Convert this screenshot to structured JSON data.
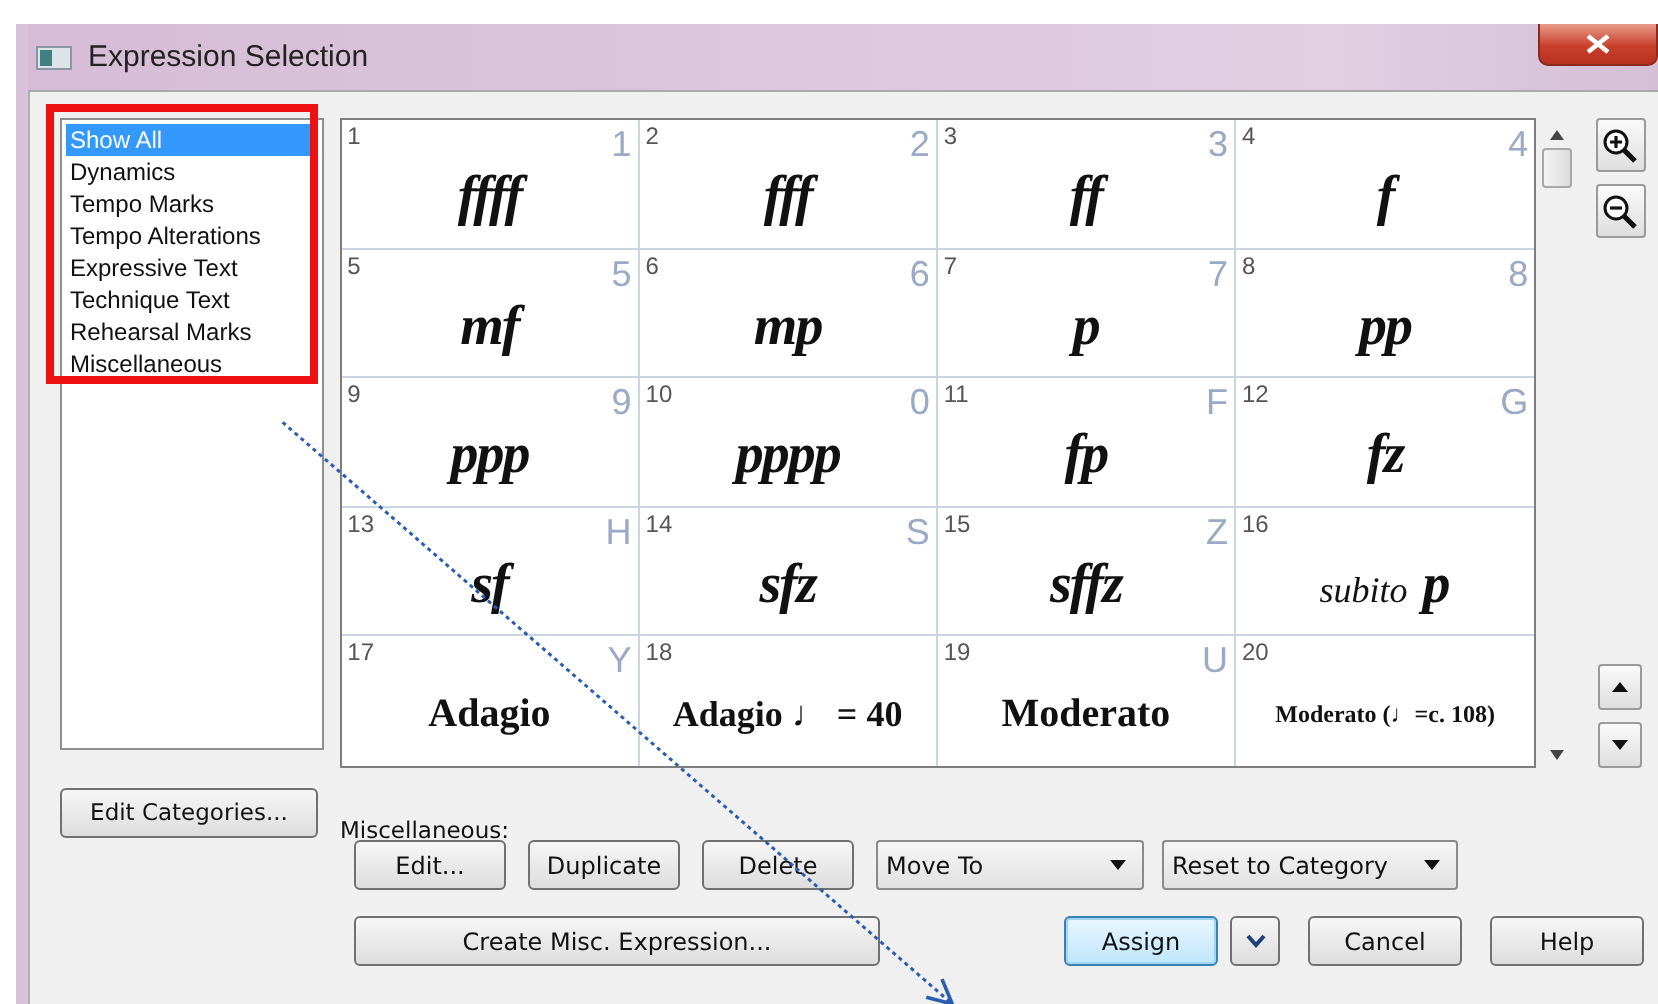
{
  "window": {
    "title": "Expression Selection"
  },
  "categories": [
    {
      "label": "Show All",
      "selected": true
    },
    {
      "label": "Dynamics",
      "selected": false
    },
    {
      "label": "Tempo Marks",
      "selected": false
    },
    {
      "label": "Tempo Alterations",
      "selected": false
    },
    {
      "label": "Expressive Text",
      "selected": false
    },
    {
      "label": "Technique Text",
      "selected": false
    },
    {
      "label": "Rehearsal Marks",
      "selected": false
    },
    {
      "label": "Miscellaneous",
      "selected": false
    }
  ],
  "edit_categories_button": "Edit Categories...",
  "expressions": [
    {
      "number": "1",
      "shortcut": "1",
      "text": "ffff",
      "kind": "dynamic"
    },
    {
      "number": "2",
      "shortcut": "2",
      "text": "fff",
      "kind": "dynamic"
    },
    {
      "number": "3",
      "shortcut": "3",
      "text": "ff",
      "kind": "dynamic"
    },
    {
      "number": "4",
      "shortcut": "4",
      "text": "f",
      "kind": "dynamic"
    },
    {
      "number": "5",
      "shortcut": "5",
      "text": "mf",
      "kind": "dynamic"
    },
    {
      "number": "6",
      "shortcut": "6",
      "text": "mp",
      "kind": "dynamic"
    },
    {
      "number": "7",
      "shortcut": "7",
      "text": "p",
      "kind": "dynamic"
    },
    {
      "number": "8",
      "shortcut": "8",
      "text": "pp",
      "kind": "dynamic"
    },
    {
      "number": "9",
      "shortcut": "9",
      "text": "ppp",
      "kind": "dynamic"
    },
    {
      "number": "10",
      "shortcut": "0",
      "text": "pppp",
      "kind": "dynamic"
    },
    {
      "number": "11",
      "shortcut": "F",
      "text": "fp",
      "kind": "dynamic"
    },
    {
      "number": "12",
      "shortcut": "G",
      "text": "fz",
      "kind": "dynamic"
    },
    {
      "number": "13",
      "shortcut": "H",
      "text": "sf",
      "kind": "dynamic"
    },
    {
      "number": "14",
      "shortcut": "S",
      "text": "sfz",
      "kind": "dynamic"
    },
    {
      "number": "15",
      "shortcut": "Z",
      "text": "sffz",
      "kind": "dynamic"
    },
    {
      "number": "16",
      "text": "subito **p**",
      "kind": "mixed"
    },
    {
      "number": "17",
      "shortcut": "Y",
      "text": "Adagio",
      "kind": "tempo"
    },
    {
      "number": "18",
      "text": "Adagio ♩ = 40",
      "kind": "tempo"
    },
    {
      "number": "19",
      "shortcut": "U",
      "text": "Moderato",
      "kind": "tempo"
    },
    {
      "number": "20",
      "text": "Moderato (♩=c. 108)",
      "kind": "tempo_small"
    }
  ],
  "category_label": "Miscellaneous:",
  "action_buttons": [
    "Edit...",
    "Duplicate",
    "Delete"
  ],
  "dropdowns": [
    "Move To",
    "Reset to Category"
  ],
  "create_button": "Create Misc. Expression...",
  "dialog_buttons": [
    {
      "label": "Assign",
      "default": true
    },
    {
      "label": "Cancel",
      "default": false
    },
    {
      "label": "Help",
      "default": false
    }
  ]
}
